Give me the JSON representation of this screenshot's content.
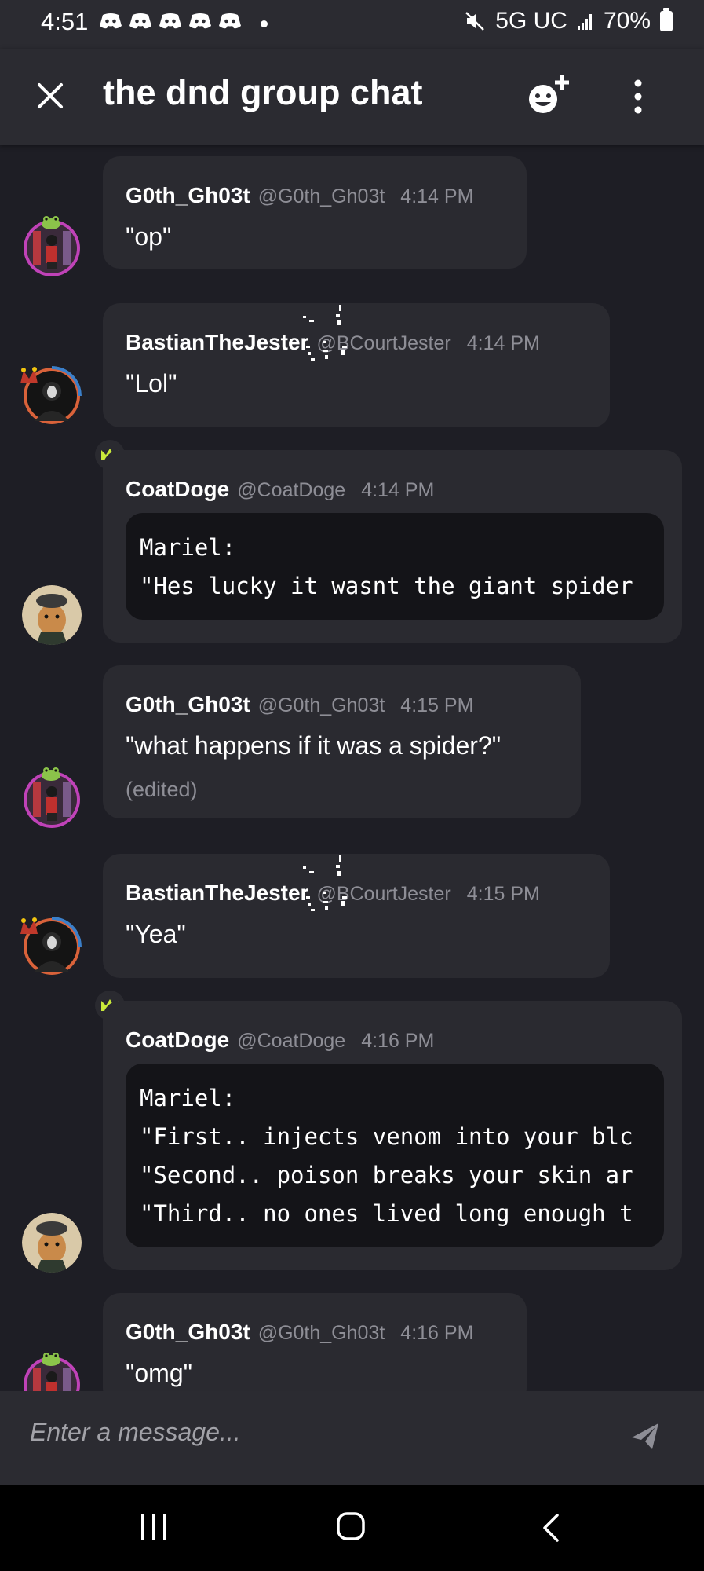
{
  "status_bar": {
    "time": "4:51",
    "network": "5G UC",
    "battery": "70%",
    "notification_icons": [
      "discord-icon",
      "discord-icon",
      "discord-icon",
      "discord-icon",
      "discord-icon"
    ]
  },
  "header": {
    "title": "the dnd group chat",
    "close_icon": "close-icon",
    "emoji_add_icon": "add-reaction-icon",
    "more_icon": "more-vertical-icon"
  },
  "messages": [
    {
      "author": "G0th_Gh03t",
      "handle": "@G0th_Gh03t",
      "time": "4:14 PM",
      "text": "\"op\""
    },
    {
      "author": "BastianThe",
      "author_styled": "Jester",
      "handle": "@BCourtJester",
      "time": "4:14 PM",
      "text": "\"Lol\""
    },
    {
      "author": "CoatDoge",
      "handle": "@CoatDoge",
      "time": "4:14 PM",
      "code": "Mariel:\n\"Hes lucky it wasnt the giant spider"
    },
    {
      "author": "G0th_Gh03t",
      "handle": "@G0th_Gh03t",
      "time": "4:15 PM",
      "text": "\"what happens if it was a spider?\"",
      "edited": "(edited)"
    },
    {
      "author": "BastianThe",
      "author_styled": "Jester",
      "handle": "@BCourtJester",
      "time": "4:15 PM",
      "text": "\"Yea\""
    },
    {
      "author": "CoatDoge",
      "handle": "@CoatDoge",
      "time": "4:16 PM",
      "code": "Mariel:\n\"First.. injects venom into your blc\n\"Second.. poison breaks your skin ar\n\"Third.. no ones lived long enough t"
    },
    {
      "author": "G0th_Gh03t",
      "handle": "@G0th_Gh03t",
      "time": "4:16 PM",
      "text": "\"omg\""
    }
  ],
  "input": {
    "placeholder": "Enter a message..."
  },
  "colors": {
    "background": "#1e1e25",
    "bubble": "#2a2a30",
    "code_block": "#141418",
    "muted_text": "#8e8e96",
    "crown": "#c8e83a"
  }
}
